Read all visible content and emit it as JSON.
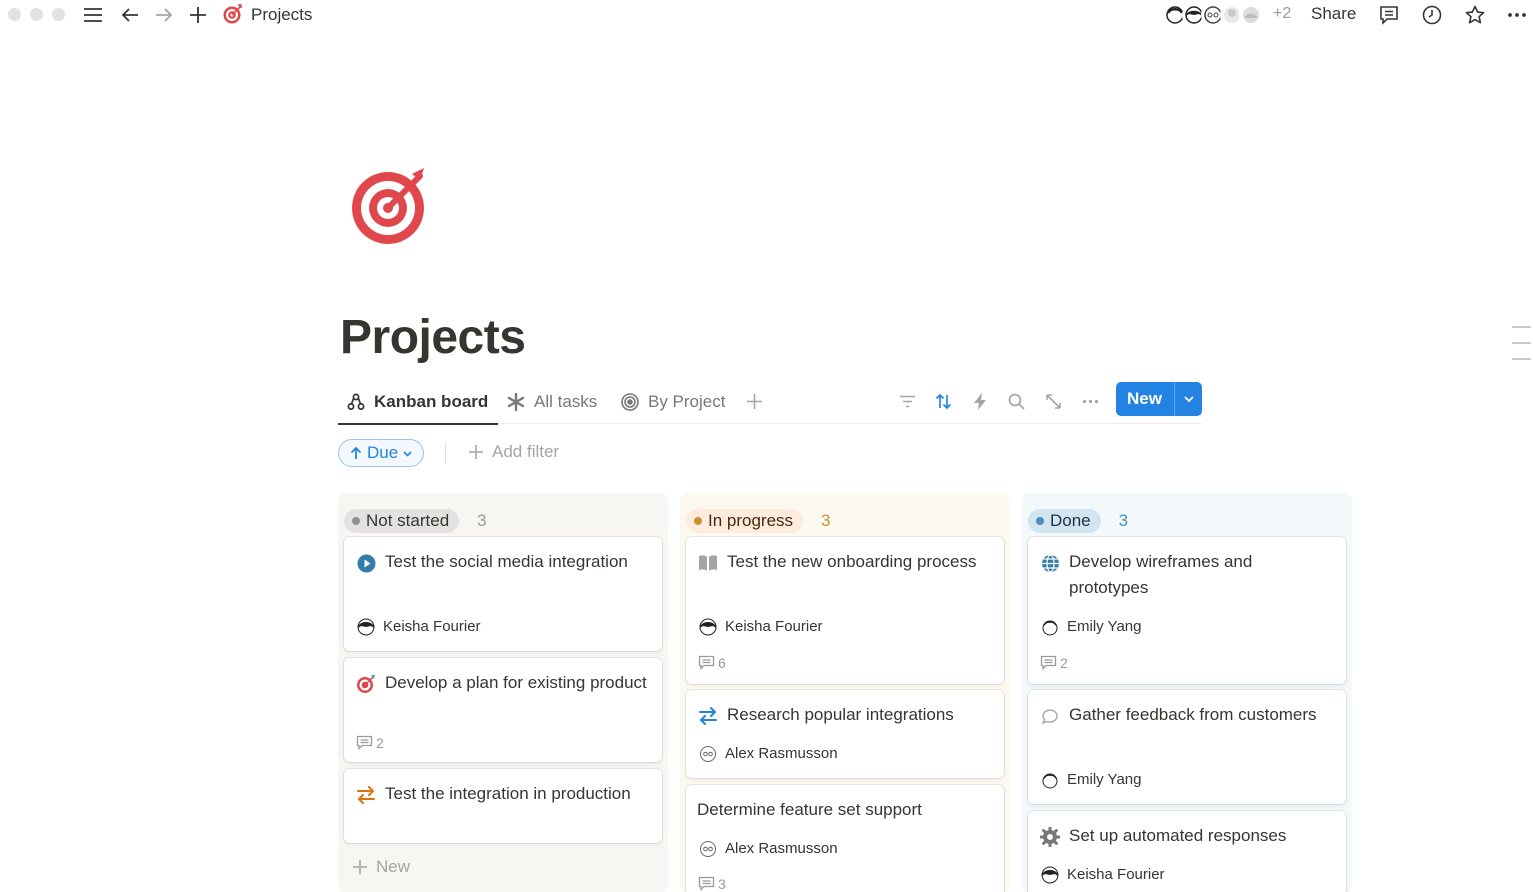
{
  "topbar": {
    "breadcrumb_title": "Projects",
    "collaborators_extra": "+2",
    "share_label": "Share"
  },
  "page": {
    "title": "Projects",
    "icon": "target-icon"
  },
  "views": {
    "tabs": [
      {
        "label": "Kanban board",
        "icon": "kanban-icon",
        "active": true
      },
      {
        "label": "All tasks",
        "icon": "asterisk-icon",
        "active": false
      },
      {
        "label": "By Project",
        "icon": "target-outline-icon",
        "active": false
      }
    ],
    "new_label": "New"
  },
  "filters": {
    "sort_label": "Due",
    "add_filter_label": "Add filter"
  },
  "colors": {
    "accent": "#2383e2",
    "not_started_bg": "#f7f6f3",
    "not_started_pill": "#e3e2e0",
    "not_started_dot": "#91918e",
    "in_progress_bg": "#fdf9f1",
    "in_progress_pill": "#fbecdd",
    "in_progress_dot": "#cb912f",
    "in_progress_text": "#89632a",
    "done_bg": "#f3f8fb",
    "done_pill": "#d3e5ef",
    "done_dot": "#4b8ebd",
    "done_text": "#28456c"
  },
  "board": {
    "columns": [
      {
        "status": "Not started",
        "count": "3",
        "cards": [
          {
            "title": "Test the social media integration",
            "icon": "play-circle-icon",
            "assignee": "Keisha Fourier",
            "comments": ""
          },
          {
            "title": "Develop a plan for existing product",
            "icon": "target-icon",
            "assignee": "",
            "comments": "2"
          },
          {
            "title": "Test the integration in production",
            "icon": "arrows-swap-icon",
            "assignee": "",
            "comments": ""
          }
        ],
        "new_label": "New"
      },
      {
        "status": "In progress",
        "count": "3",
        "cards": [
          {
            "title": "Test the new onboarding process",
            "icon": "book-icon",
            "assignee": "Keisha Fourier",
            "comments": "6"
          },
          {
            "title": "Research popular integrations",
            "icon": "arrows-swap-icon",
            "assignee": "Alex Rasmusson",
            "comments": ""
          },
          {
            "title": "Determine feature set support",
            "icon": "",
            "assignee": "Alex Rasmusson",
            "comments": "3"
          }
        ]
      },
      {
        "status": "Done",
        "count": "3",
        "cards": [
          {
            "title": "Develop wireframes and prototypes",
            "icon": "globe-icon",
            "assignee": "Emily Yang",
            "comments": "2"
          },
          {
            "title": "Gather feedback from customers",
            "icon": "speech-bubble-icon",
            "assignee": "Emily Yang",
            "comments": ""
          },
          {
            "title": "Set up automated responses",
            "icon": "gear-icon",
            "assignee": "Keisha Fourier",
            "comments": ""
          }
        ]
      }
    ]
  }
}
